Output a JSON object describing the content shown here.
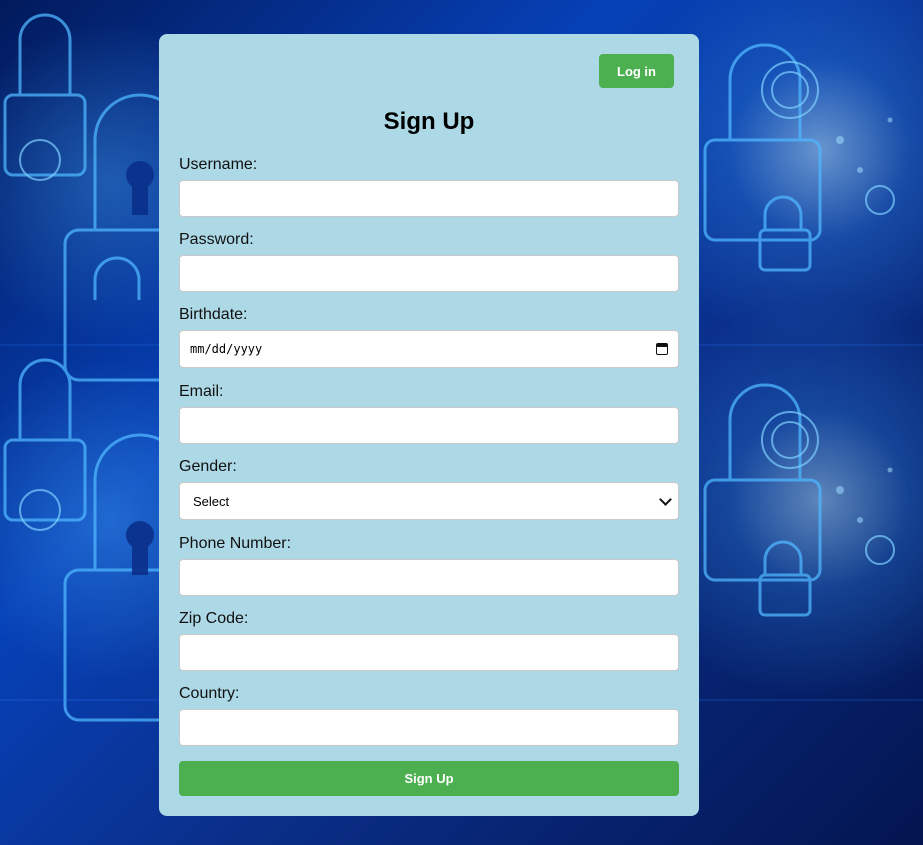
{
  "header": {
    "login_label": "Log in"
  },
  "form": {
    "title": "Sign Up",
    "username_label": "Username:",
    "username_value": "",
    "password_label": "Password:",
    "password_value": "",
    "birthdate_label": "Birthdate:",
    "birthdate_placeholder": "mm/dd/yyyy",
    "email_label": "Email:",
    "email_value": "",
    "gender_label": "Gender:",
    "gender_selected": "Select",
    "phone_label": "Phone Number:",
    "phone_value": "",
    "zip_label": "Zip Code:",
    "zip_value": "",
    "country_label": "Country:",
    "country_value": "",
    "submit_label": "Sign Up"
  },
  "colors": {
    "card_background": "#add8e6",
    "button_green": "#4caf50",
    "page_background": "#0641b8"
  },
  "icons": {
    "date_picker": "calendar-icon",
    "select_arrow": "chevron-down-icon"
  }
}
